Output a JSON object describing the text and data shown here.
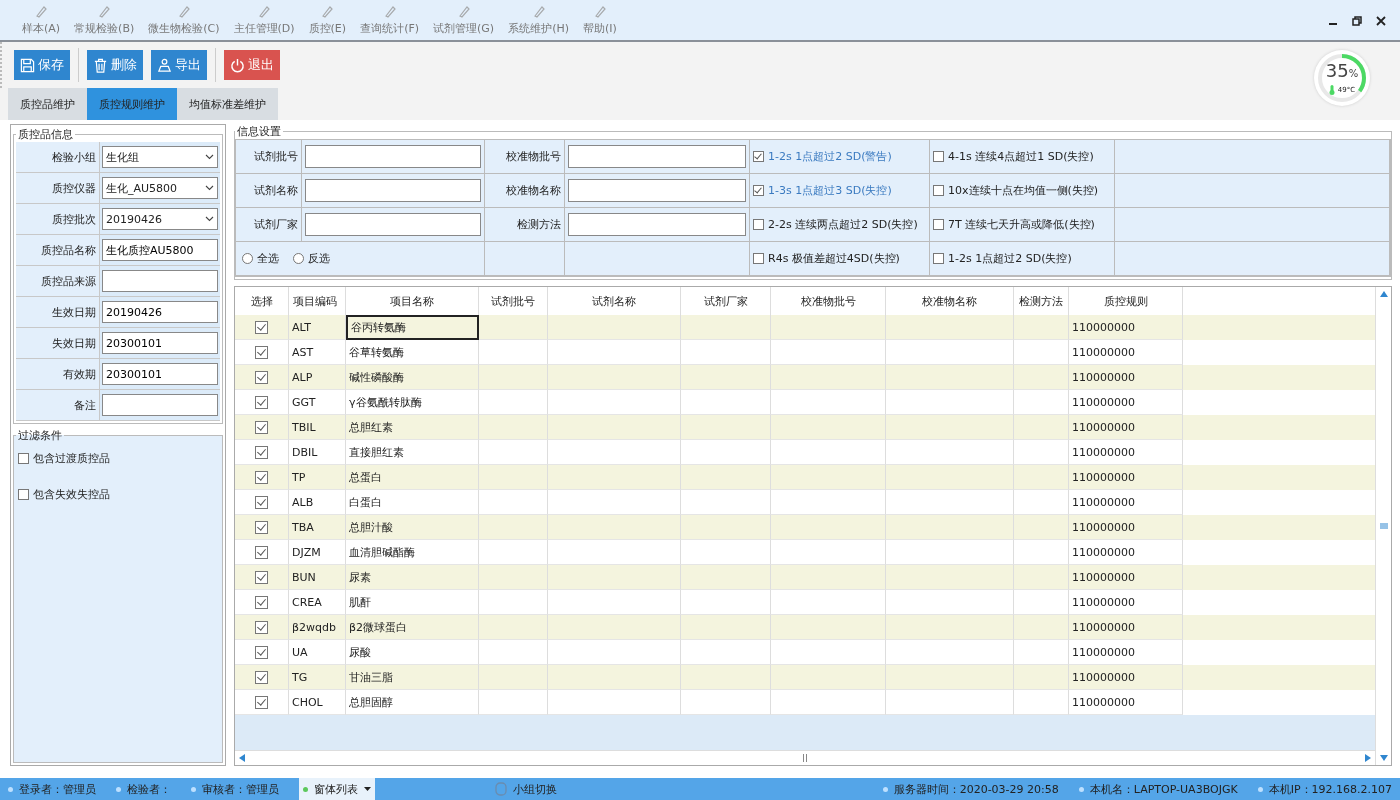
{
  "menu": [
    "样本(A)",
    "常规检验(B)",
    "微生物检验(C)",
    "主任管理(D)",
    "质控(E)",
    "查询统计(F)",
    "试剂管理(G)",
    "系统维护(H)",
    "帮助(I)"
  ],
  "toolbar": [
    {
      "label": "保存",
      "kind": "save"
    },
    {
      "label": "删除",
      "kind": "delete"
    },
    {
      "label": "导出",
      "kind": "export"
    },
    {
      "label": "退出",
      "kind": "exit"
    }
  ],
  "tabs": [
    {
      "label": "质控品维护",
      "selected": false
    },
    {
      "label": "质控规则维护",
      "selected": true
    },
    {
      "label": "均值标准差维护",
      "selected": false
    }
  ],
  "gauge": {
    "value": "35",
    "unit": "%",
    "temperature": "49°C",
    "level": 0.35
  },
  "qc_info": {
    "title": "质控品信息",
    "fields": [
      {
        "label": "检验小组",
        "value": "生化组",
        "kind": "select"
      },
      {
        "label": "质控仪器",
        "value": "生化_AU5800",
        "kind": "select"
      },
      {
        "label": "质控批次",
        "value": "20190426",
        "kind": "select"
      },
      {
        "label": "质控品名称",
        "value": "生化质控AU5800",
        "kind": "input"
      },
      {
        "label": "质控品来源",
        "kind": "input"
      },
      {
        "label": "生效日期",
        "value": "20190426",
        "kind": "input"
      },
      {
        "label": "失效日期",
        "value": "20300101",
        "kind": "input"
      },
      {
        "label": "有效期",
        "value": "20300101",
        "kind": "input"
      },
      {
        "label": "备注",
        "kind": "input"
      }
    ]
  },
  "filter": {
    "title": "过滤条件",
    "options": [
      {
        "label": "包含过渡质控品",
        "checked": false
      },
      {
        "label": "包含失效失控品",
        "checked": false
      }
    ]
  },
  "info_settings": {
    "title": "信息设置",
    "rows": [
      {
        "fields": [
          {
            "label": "试剂批号"
          },
          {
            "label": "校准物批号"
          }
        ],
        "rules": [
          {
            "label": "1-2s  1点超过2 SD(警告)",
            "checked": true
          },
          {
            "label": "4-1s  连续4点超过1 SD(失控)",
            "checked": false
          }
        ]
      },
      {
        "fields": [
          {
            "label": "试剂名称"
          },
          {
            "label": "校准物名称"
          }
        ],
        "rules": [
          {
            "label": "1-3s  1点超过3 SD(失控)",
            "checked": true
          },
          {
            "label": "10x连续十点在均值一侧(失控)",
            "checked": false
          }
        ]
      },
      {
        "fields": [
          {
            "label": "试剂厂家"
          },
          {
            "label": "检测方法"
          }
        ],
        "rules": [
          {
            "label": "2-2s  连续两点超过2 SD(失控)",
            "checked": false
          },
          {
            "label": "7T  连续七天升高或降低(失控)",
            "checked": false
          }
        ]
      }
    ],
    "radios": [
      {
        "label": "全选",
        "selected": false
      },
      {
        "label": "反选",
        "selected": false
      }
    ],
    "last_rules": [
      {
        "label": "R4s  极值差超过4SD(失控)",
        "checked": false
      },
      {
        "label": "1-2s  1点超过2 SD(失控)",
        "checked": false
      }
    ]
  },
  "grid": {
    "columns": [
      "选择",
      "项目编码",
      "项目名称",
      "试剂批号",
      "试剂名称",
      "试剂厂家",
      "校准物批号",
      "校准物名称",
      "检测方法",
      "质控规则"
    ],
    "rows": [
      {
        "checked": true,
        "code": "ALT",
        "name": "谷丙转氨酶",
        "rule": "110000000",
        "focused": true
      },
      {
        "checked": true,
        "code": "AST",
        "name": "谷草转氨酶",
        "rule": "110000000",
        "focused": false
      },
      {
        "checked": true,
        "code": "ALP",
        "name": "碱性磷酸酶",
        "rule": "110000000",
        "focused": false
      },
      {
        "checked": true,
        "code": "GGT",
        "name": "γ谷氨酰转肽酶",
        "rule": "110000000",
        "focused": false
      },
      {
        "checked": true,
        "code": "TBIL",
        "name": "总胆红素",
        "rule": "110000000",
        "focused": false
      },
      {
        "checked": true,
        "code": "DBIL",
        "name": "直接胆红素",
        "rule": "110000000",
        "focused": false
      },
      {
        "checked": true,
        "code": "TP",
        "name": "总蛋白",
        "rule": "110000000",
        "focused": false
      },
      {
        "checked": true,
        "code": "ALB",
        "name": "白蛋白",
        "rule": "110000000",
        "focused": false
      },
      {
        "checked": true,
        "code": "TBA",
        "name": "总胆汁酸",
        "rule": "110000000",
        "focused": false
      },
      {
        "checked": true,
        "code": "DJZM",
        "name": "血清胆碱酯酶",
        "rule": "110000000",
        "focused": false
      },
      {
        "checked": true,
        "code": "BUN",
        "name": "尿素",
        "rule": "110000000",
        "focused": false
      },
      {
        "checked": true,
        "code": "CREA",
        "name": "肌酐",
        "rule": "110000000",
        "focused": false
      },
      {
        "checked": true,
        "code": "β2wqdb",
        "name": "β2微球蛋白",
        "rule": "110000000",
        "focused": false
      },
      {
        "checked": true,
        "code": "UA",
        "name": "尿酸",
        "rule": "110000000",
        "focused": false
      },
      {
        "checked": true,
        "code": "TG",
        "name": "甘油三脂",
        "rule": "110000000",
        "focused": false
      },
      {
        "checked": true,
        "code": "CHOL",
        "name": "总胆固醇",
        "rule": "110000000",
        "focused": false
      }
    ]
  },
  "status_left": [
    {
      "label": "登录者：管理员",
      "kind": "info"
    },
    {
      "label": "检验者：",
      "kind": "info"
    },
    {
      "label": "审核者：管理员",
      "kind": "info"
    },
    {
      "label": "窗体列表",
      "kind": "menu"
    },
    {
      "label": "小组切换",
      "kind": "switch"
    }
  ],
  "status_right": [
    "服务器时间：2020-03-29 20:58",
    "本机名：LAPTOP-UA3BOJGK",
    "本机IP：192.168.2.107"
  ]
}
